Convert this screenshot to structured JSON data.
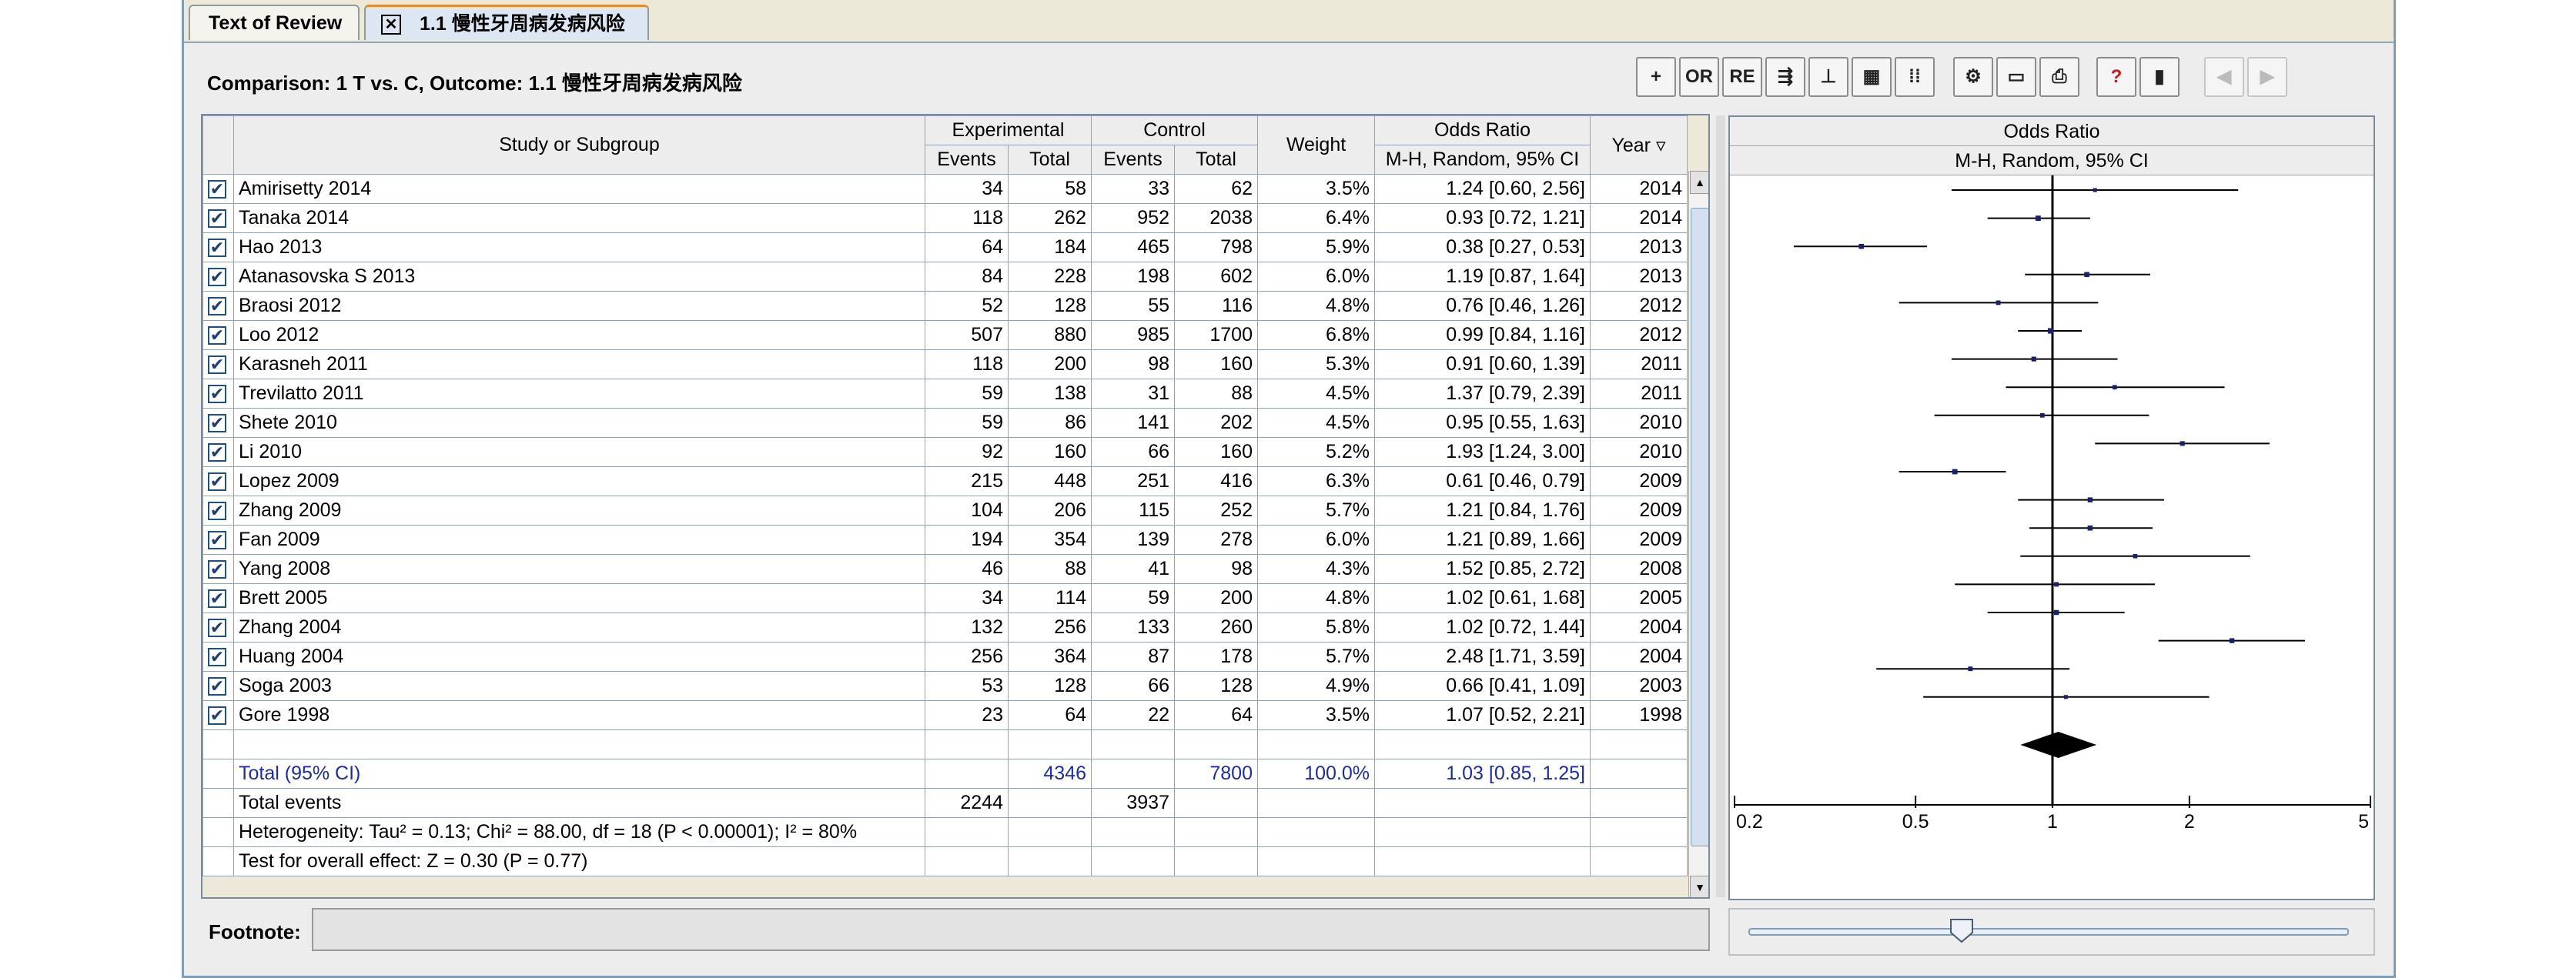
{
  "tabs": [
    {
      "label": "Text of Review"
    },
    {
      "label": "1.1 慢性牙周病发病风险"
    }
  ],
  "heading": "Comparison: 1 T vs. C, Outcome: 1.1 慢性牙周病发病风险",
  "toolbar": {
    "buttons": [
      {
        "name": "add-icon",
        "label": "+"
      },
      {
        "name": "or-button",
        "label": "OR"
      },
      {
        "name": "re-button",
        "label": "RE"
      },
      {
        "name": "forest-plot-icon",
        "label": "⇶"
      },
      {
        "name": "funnel-plot-icon",
        "label": "⊥"
      },
      {
        "name": "calculator-icon",
        "label": "▦"
      },
      {
        "name": "grid-icon",
        "label": "⁞⁞"
      },
      {
        "name": "settings-icon",
        "label": "⚙"
      },
      {
        "name": "note-icon",
        "label": "▭"
      },
      {
        "name": "print-icon",
        "label": "⎙"
      },
      {
        "name": "help-icon",
        "label": "?"
      },
      {
        "name": "book-icon",
        "label": "▮"
      },
      {
        "name": "back-arrow-icon",
        "label": "◀"
      },
      {
        "name": "forward-arrow-icon",
        "label": "▶"
      }
    ]
  },
  "table": {
    "headers": {
      "study": "Study or Subgroup",
      "experimental": "Experimental",
      "control": "Control",
      "events": "Events",
      "total": "Total",
      "weight": "Weight",
      "odds_ratio": "Odds Ratio",
      "method": "M-H, Random, 95% CI",
      "year": "Year"
    },
    "rows": [
      {
        "study": "Amirisetty 2014",
        "e_events": "34",
        "e_total": "58",
        "c_events": "33",
        "c_total": "62",
        "weight": "3.5%",
        "or": "1.24 [0.60, 2.56]",
        "year": "2014"
      },
      {
        "study": "Tanaka 2014",
        "e_events": "118",
        "e_total": "262",
        "c_events": "952",
        "c_total": "2038",
        "weight": "6.4%",
        "or": "0.93 [0.72, 1.21]",
        "year": "2014"
      },
      {
        "study": "Hao 2013",
        "e_events": "64",
        "e_total": "184",
        "c_events": "465",
        "c_total": "798",
        "weight": "5.9%",
        "or": "0.38 [0.27, 0.53]",
        "year": "2013"
      },
      {
        "study": "Atanasovska S 2013",
        "e_events": "84",
        "e_total": "228",
        "c_events": "198",
        "c_total": "602",
        "weight": "6.0%",
        "or": "1.19 [0.87, 1.64]",
        "year": "2013"
      },
      {
        "study": "Braosi 2012",
        "e_events": "52",
        "e_total": "128",
        "c_events": "55",
        "c_total": "116",
        "weight": "4.8%",
        "or": "0.76 [0.46, 1.26]",
        "year": "2012"
      },
      {
        "study": "Loo 2012",
        "e_events": "507",
        "e_total": "880",
        "c_events": "985",
        "c_total": "1700",
        "weight": "6.8%",
        "or": "0.99 [0.84, 1.16]",
        "year": "2012"
      },
      {
        "study": "Karasneh 2011",
        "e_events": "118",
        "e_total": "200",
        "c_events": "98",
        "c_total": "160",
        "weight": "5.3%",
        "or": "0.91 [0.60, 1.39]",
        "year": "2011"
      },
      {
        "study": "Trevilatto 2011",
        "e_events": "59",
        "e_total": "138",
        "c_events": "31",
        "c_total": "88",
        "weight": "4.5%",
        "or": "1.37 [0.79, 2.39]",
        "year": "2011"
      },
      {
        "study": "Shete 2010",
        "e_events": "59",
        "e_total": "86",
        "c_events": "141",
        "c_total": "202",
        "weight": "4.5%",
        "or": "0.95 [0.55, 1.63]",
        "year": "2010"
      },
      {
        "study": "Li 2010",
        "e_events": "92",
        "e_total": "160",
        "c_events": "66",
        "c_total": "160",
        "weight": "5.2%",
        "or": "1.93 [1.24, 3.00]",
        "year": "2010"
      },
      {
        "study": "Lopez 2009",
        "e_events": "215",
        "e_total": "448",
        "c_events": "251",
        "c_total": "416",
        "weight": "6.3%",
        "or": "0.61 [0.46, 0.79]",
        "year": "2009"
      },
      {
        "study": "Zhang 2009",
        "e_events": "104",
        "e_total": "206",
        "c_events": "115",
        "c_total": "252",
        "weight": "5.7%",
        "or": "1.21 [0.84, 1.76]",
        "year": "2009"
      },
      {
        "study": "Fan 2009",
        "e_events": "194",
        "e_total": "354",
        "c_events": "139",
        "c_total": "278",
        "weight": "6.0%",
        "or": "1.21 [0.89, 1.66]",
        "year": "2009"
      },
      {
        "study": "Yang 2008",
        "e_events": "46",
        "e_total": "88",
        "c_events": "41",
        "c_total": "98",
        "weight": "4.3%",
        "or": "1.52 [0.85, 2.72]",
        "year": "2008"
      },
      {
        "study": "Brett 2005",
        "e_events": "34",
        "e_total": "114",
        "c_events": "59",
        "c_total": "200",
        "weight": "4.8%",
        "or": "1.02 [0.61, 1.68]",
        "year": "2005"
      },
      {
        "study": "Zhang 2004",
        "e_events": "132",
        "e_total": "256",
        "c_events": "133",
        "c_total": "260",
        "weight": "5.8%",
        "or": "1.02 [0.72, 1.44]",
        "year": "2004"
      },
      {
        "study": "Huang 2004",
        "e_events": "256",
        "e_total": "364",
        "c_events": "87",
        "c_total": "178",
        "weight": "5.7%",
        "or": "2.48 [1.71, 3.59]",
        "year": "2004"
      },
      {
        "study": "Soga 2003",
        "e_events": "53",
        "e_total": "128",
        "c_events": "66",
        "c_total": "128",
        "weight": "4.9%",
        "or": "0.66 [0.41, 1.09]",
        "year": "2003"
      },
      {
        "study": "Gore 1998",
        "e_events": "23",
        "e_total": "64",
        "c_events": "22",
        "c_total": "64",
        "weight": "3.5%",
        "or": "1.07 [0.52, 2.21]",
        "year": "1998"
      }
    ],
    "total": {
      "label": "Total (95% CI)",
      "e_total": "4346",
      "c_total": "7800",
      "weight": "100.0%",
      "or": "1.03 [0.85, 1.25]"
    },
    "total_events": {
      "label": "Total events",
      "e_events": "2244",
      "c_events": "3937"
    },
    "heterogeneity": "Heterogeneity: Tau² = 0.13; Chi² = 88.00, df = 18 (P < 0.00001); I² = 80%",
    "overall_effect": "Test for overall effect: Z = 0.30 (P = 0.77)"
  },
  "plot": {
    "header": "Odds Ratio",
    "subheader": "M-H, Random, 95% CI",
    "tick_labels": [
      "0.2",
      "0.5",
      "1",
      "2",
      "5"
    ]
  },
  "chart_data": {
    "type": "forest",
    "scale": "log",
    "xlim": [
      0.2,
      5
    ],
    "ticks": [
      0.2,
      0.5,
      1,
      2,
      5
    ],
    "studies": [
      {
        "study": "Amirisetty 2014",
        "or": 1.24,
        "lo": 0.6,
        "hi": 2.56,
        "weight": 3.5
      },
      {
        "study": "Tanaka 2014",
        "or": 0.93,
        "lo": 0.72,
        "hi": 1.21,
        "weight": 6.4
      },
      {
        "study": "Hao 2013",
        "or": 0.38,
        "lo": 0.27,
        "hi": 0.53,
        "weight": 5.9
      },
      {
        "study": "Atanasovska S 2013",
        "or": 1.19,
        "lo": 0.87,
        "hi": 1.64,
        "weight": 6.0
      },
      {
        "study": "Braosi 2012",
        "or": 0.76,
        "lo": 0.46,
        "hi": 1.26,
        "weight": 4.8
      },
      {
        "study": "Loo 2012",
        "or": 0.99,
        "lo": 0.84,
        "hi": 1.16,
        "weight": 6.8
      },
      {
        "study": "Karasneh 2011",
        "or": 0.91,
        "lo": 0.6,
        "hi": 1.39,
        "weight": 5.3
      },
      {
        "study": "Trevilatto 2011",
        "or": 1.37,
        "lo": 0.79,
        "hi": 2.39,
        "weight": 4.5
      },
      {
        "study": "Shete 2010",
        "or": 0.95,
        "lo": 0.55,
        "hi": 1.63,
        "weight": 4.5
      },
      {
        "study": "Li 2010",
        "or": 1.93,
        "lo": 1.24,
        "hi": 3.0,
        "weight": 5.2
      },
      {
        "study": "Lopez 2009",
        "or": 0.61,
        "lo": 0.46,
        "hi": 0.79,
        "weight": 6.3
      },
      {
        "study": "Zhang 2009",
        "or": 1.21,
        "lo": 0.84,
        "hi": 1.76,
        "weight": 5.7
      },
      {
        "study": "Fan 2009",
        "or": 1.21,
        "lo": 0.89,
        "hi": 1.66,
        "weight": 6.0
      },
      {
        "study": "Yang 2008",
        "or": 1.52,
        "lo": 0.85,
        "hi": 2.72,
        "weight": 4.3
      },
      {
        "study": "Brett 2005",
        "or": 1.02,
        "lo": 0.61,
        "hi": 1.68,
        "weight": 4.8
      },
      {
        "study": "Zhang 2004",
        "or": 1.02,
        "lo": 0.72,
        "hi": 1.44,
        "weight": 5.8
      },
      {
        "study": "Huang 2004",
        "or": 2.48,
        "lo": 1.71,
        "hi": 3.59,
        "weight": 5.7
      },
      {
        "study": "Soga 2003",
        "or": 0.66,
        "lo": 0.41,
        "hi": 1.09,
        "weight": 4.9
      },
      {
        "study": "Gore 1998",
        "or": 1.07,
        "lo": 0.52,
        "hi": 2.21,
        "weight": 3.5
      }
    ],
    "pooled": {
      "or": 1.03,
      "lo": 0.85,
      "hi": 1.25
    }
  },
  "footnote": {
    "label": "Footnote:",
    "value": ""
  },
  "colors": {
    "accent": "#1a2bb0",
    "marker": "#1a2070",
    "border": "#7f9db9"
  }
}
